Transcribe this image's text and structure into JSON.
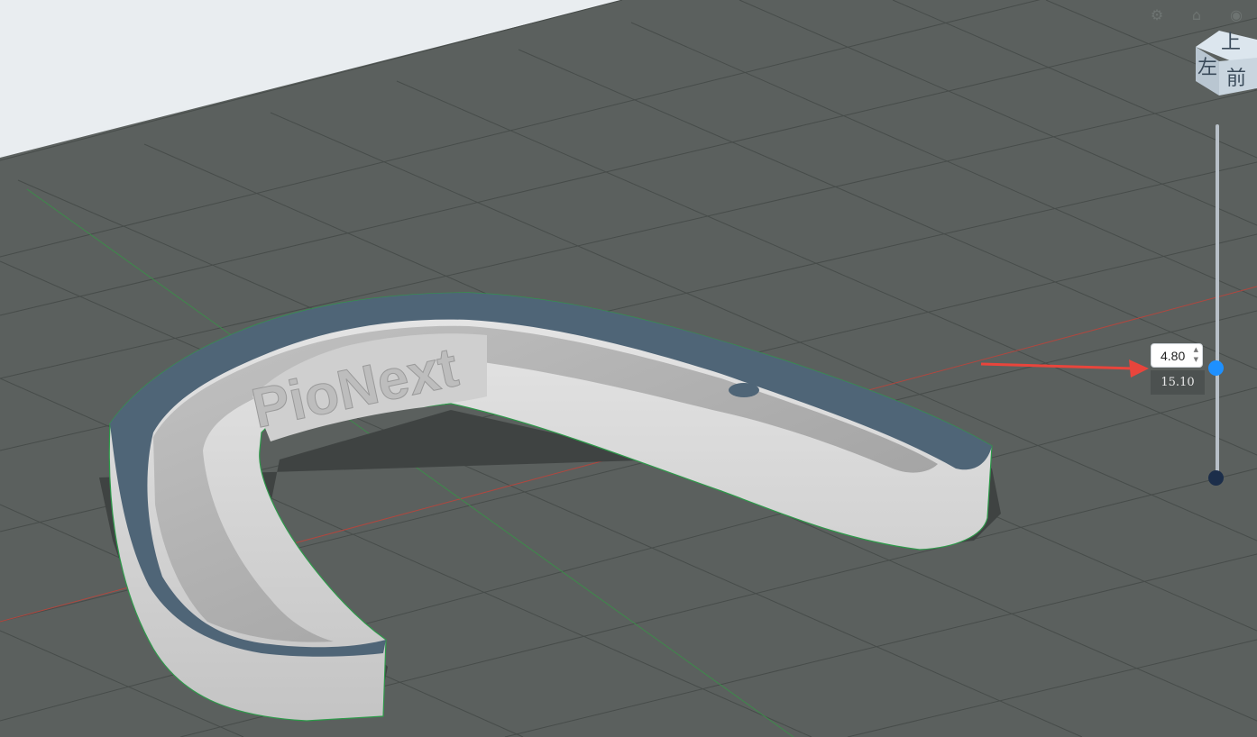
{
  "toolbar": {
    "icons": [
      "settings-icon",
      "home-icon",
      "eye-icon"
    ]
  },
  "view_cube": {
    "top_label": "上",
    "front_label": "前",
    "left_label": "左"
  },
  "model": {
    "embossed_text": "PioNext"
  },
  "layer_slider": {
    "current_value": "4.80",
    "max_height_label": "15.10",
    "position_fraction": 0.32
  },
  "colors": {
    "viewport_background": "#5b605e",
    "build_plate_background": "#e9edf0",
    "model_surface": "#d8d8d8",
    "model_rim": "#4f6577",
    "slider_active": "#1e90ff",
    "slider_bottom": "#1c2e4a",
    "annotation_arrow": "#e8453c",
    "x_axis": "#b0473f",
    "y_axis": "#3d8a4a"
  }
}
